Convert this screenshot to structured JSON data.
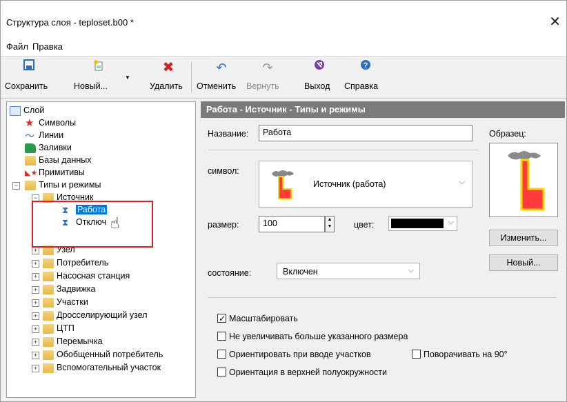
{
  "window": {
    "title": "Структура слоя - teploset.b00 *",
    "close_glyph": "✕"
  },
  "menu": [
    "Файл",
    "Правка"
  ],
  "toolbar": {
    "save": "Сохранить",
    "new": "Новый...",
    "delete": "Удалить",
    "undo": "Отменить",
    "redo": "Вернуть",
    "exit": "Выход",
    "help": "Справка"
  },
  "tree": {
    "root": "Слой",
    "items": {
      "symbols": "Символы",
      "lines": "Линии",
      "fills": "Заливки",
      "databases": "Базы данных",
      "primitives": "Примитивы",
      "types": "Типы и режимы",
      "source": "Источник",
      "source_work": "Работа",
      "source_off": "Отключ",
      "node": "Узел",
      "consumer": "Потребитель",
      "pump": "Насосная станция",
      "valve": "Задвижка",
      "sections": "Участки",
      "throttle": "Дросселирующий узел",
      "ctp": "ЦТП",
      "jumper": "Перемычка",
      "general_consumer": "Обобщенный потребитель",
      "aux_section": "Вспомогательный участок"
    }
  },
  "panel": {
    "header": "Работа - Источник - Типы и режимы",
    "name_label": "Название:",
    "name_value": "Работа",
    "sample_label": "Образец:",
    "symbol_label": "символ:",
    "symbol_value": "Источник (работа)",
    "size_label": "размер:",
    "size_value": "100",
    "color_label": "цвет:",
    "color_value": "#000000",
    "change_button": "Изменить...",
    "new_button": "Новый...",
    "state_label": "состояние:",
    "state_value": "Включен",
    "checkboxes": {
      "scale": {
        "label": "Масштабировать",
        "checked": true
      },
      "no_enlarge": {
        "label": "Не увеличивать больше указанного размера",
        "checked": false
      },
      "orient_input": {
        "label": "Ориентировать при вводе участков",
        "checked": false
      },
      "rotate90": {
        "label": "Поворачивать на 90°",
        "checked": false
      },
      "orient_upper": {
        "label": "Ориентация в верхней полуокружности",
        "checked": false
      }
    }
  },
  "colors": {
    "symbol_fill": "#ff3b3b",
    "symbol_outline": "#ffd400",
    "smoke": "#8a8a8a"
  }
}
